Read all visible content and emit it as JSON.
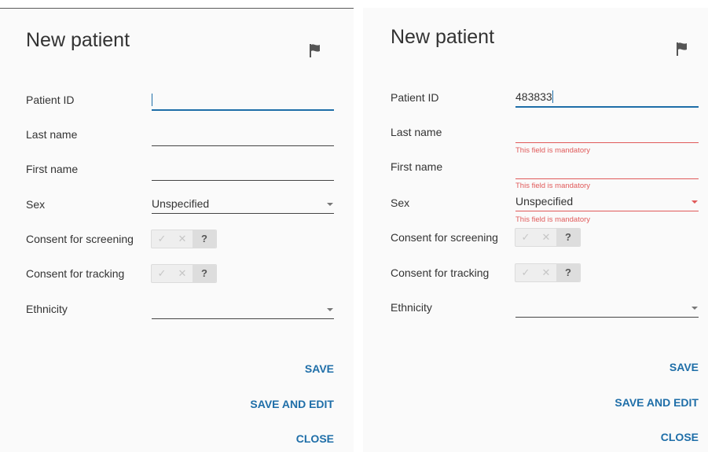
{
  "left_dialog": {
    "title": "New patient",
    "flag_icon": "flag-icon",
    "fields": {
      "patient_id": {
        "label": "Patient ID",
        "value": ""
      },
      "last_name": {
        "label": "Last name",
        "value": ""
      },
      "first_name": {
        "label": "First name",
        "value": ""
      },
      "sex": {
        "label": "Sex",
        "value": "Unspecified"
      },
      "consent_screening": {
        "label": "Consent for screening",
        "options": [
          "✓",
          "✕",
          "?"
        ],
        "selected": "?"
      },
      "consent_tracking": {
        "label": "Consent for tracking",
        "options": [
          "✓",
          "✕",
          "?"
        ],
        "selected": "?"
      },
      "ethnicity": {
        "label": "Ethnicity",
        "value": ""
      }
    },
    "actions": {
      "save": "SAVE",
      "save_and_edit": "SAVE AND EDIT",
      "close": "CLOSE"
    }
  },
  "right_dialog": {
    "title": "New patient",
    "flag_icon": "flag-icon",
    "fields": {
      "patient_id": {
        "label": "Patient ID",
        "value": "483833"
      },
      "last_name": {
        "label": "Last name",
        "value": "",
        "error": "This field is mandatory"
      },
      "first_name": {
        "label": "First name",
        "value": "",
        "error": "This field is mandatory"
      },
      "sex": {
        "label": "Sex",
        "value": "Unspecified",
        "error": "This field is mandatory"
      },
      "consent_screening": {
        "label": "Consent for screening",
        "options": [
          "✓",
          "✕",
          "?"
        ],
        "selected": "?"
      },
      "consent_tracking": {
        "label": "Consent for tracking",
        "options": [
          "✓",
          "✕",
          "?"
        ],
        "selected": "?"
      },
      "ethnicity": {
        "label": "Ethnicity",
        "value": ""
      }
    },
    "actions": {
      "save": "SAVE",
      "save_and_edit": "SAVE AND EDIT",
      "close": "CLOSE"
    }
  },
  "colors": {
    "accent": "#1e6ea8",
    "error": "#e05a5a",
    "text": "#333333",
    "panel_bg": "#fafafa"
  }
}
